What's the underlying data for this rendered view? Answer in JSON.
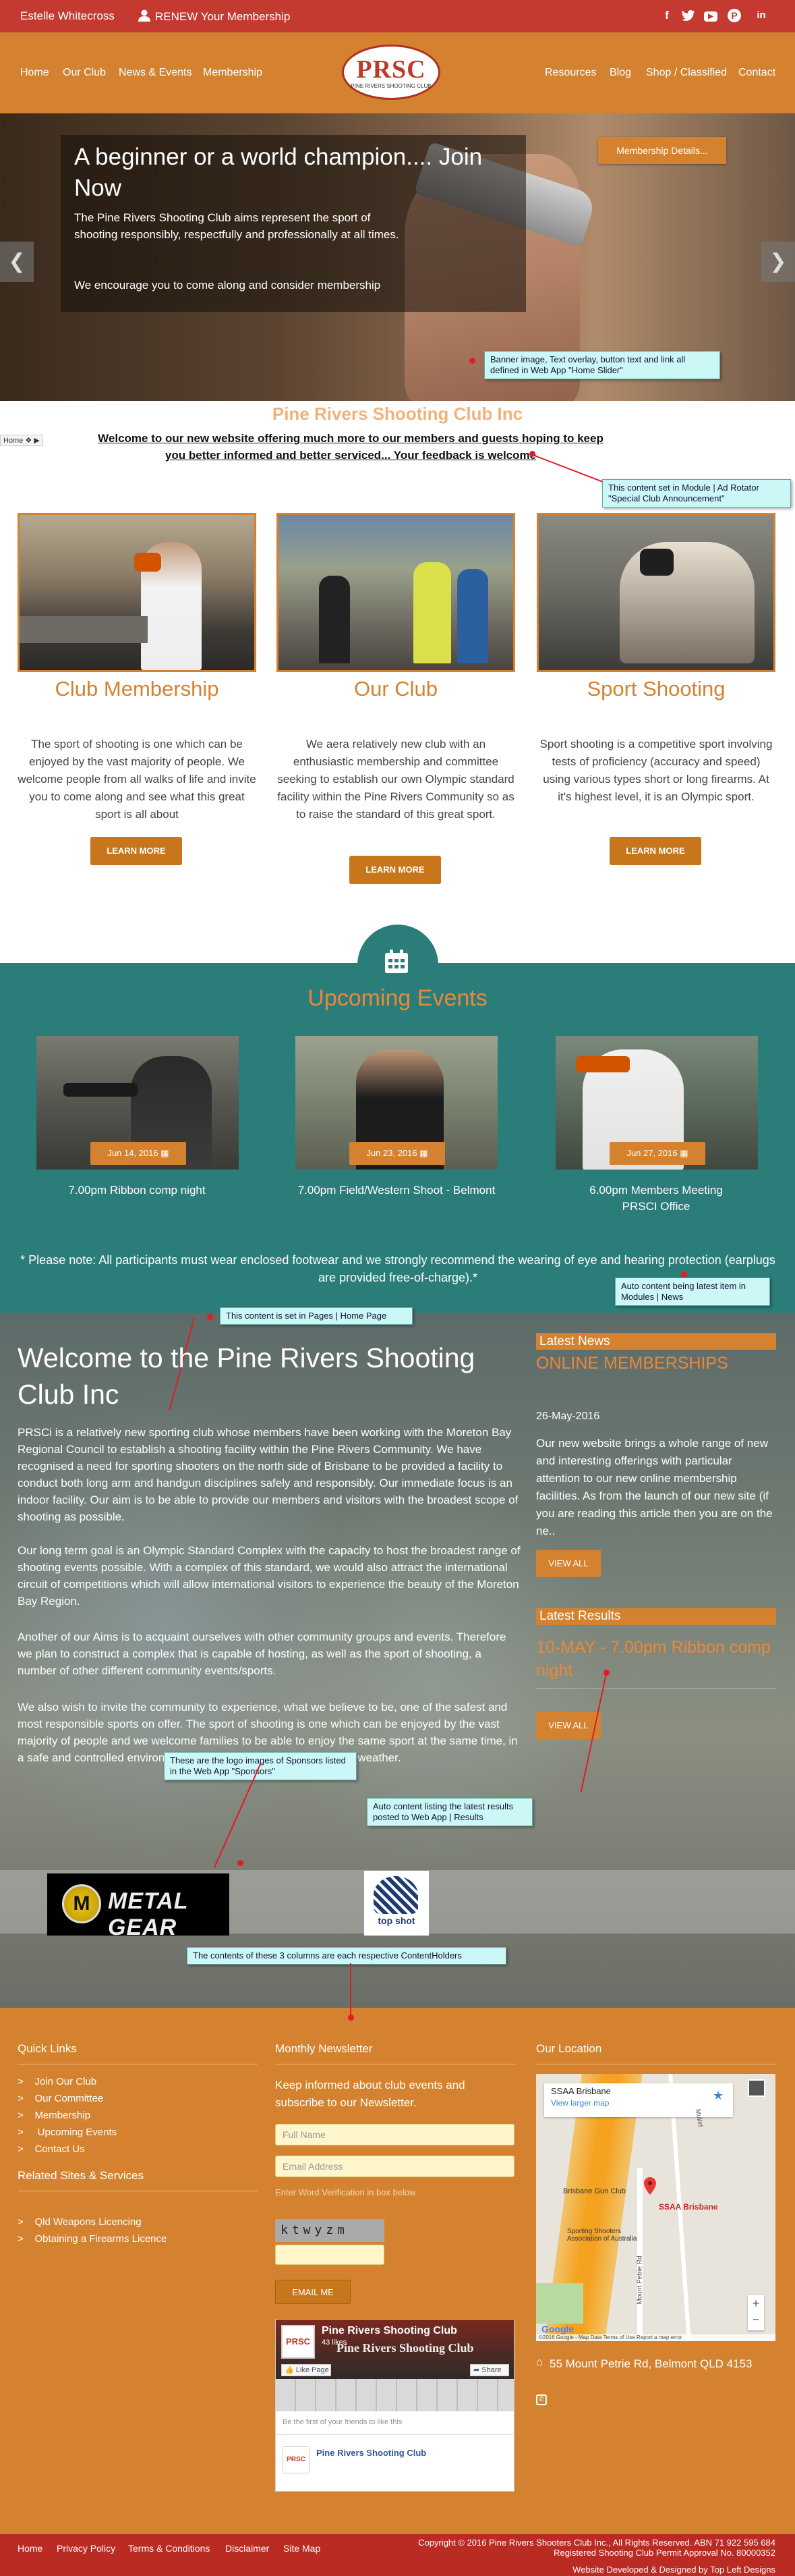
{
  "topbar": {
    "user_name": "Estelle Whitecross",
    "renew_label": "RENEW Your Membership",
    "social": [
      "f",
      "t",
      "▶",
      "P",
      "in"
    ],
    "social_names": [
      "facebook-icon",
      "twitter-icon",
      "youtube-icon",
      "pinterest-icon",
      "linkedin-icon"
    ]
  },
  "nav": {
    "left": [
      "Home",
      "Our Club",
      "News & Events",
      "Membership"
    ],
    "right": [
      "Resources",
      "Blog",
      "Shop / Classified",
      "Contact"
    ],
    "logo_text": "PRSC",
    "logo_sub": "PINE RIVERS SHOOTING CLUB"
  },
  "hero": {
    "heading": "A beginner or a world champion.... Join Now",
    "para1": "The Pine Rivers Shooting Club aims represent the sport of shooting responsibly, respectfully and professionally at all times.",
    "para2": "We encourage you to come along and consider membership",
    "button": "Membership Details...",
    "prev": "❮",
    "next": "❯"
  },
  "notes": {
    "banner": "Banner image, Text overlay, button text and link all defined in Web App \"Home Slider\"",
    "announcement": "This content set in Module | Ad Rotator \"Special Club Announcement\"",
    "pages": "This content is set in Pages | Home Page",
    "autonews": "Auto content being latest item in Modules | News",
    "sponsors": "These are the logo images of Sponsors listed in the Web App \"Sponsors\"",
    "results": "Auto content listing the latest results posted to Web App | Results",
    "contentholders": "The contents of these 3 columns are each respective ContentHolders"
  },
  "announcement": {
    "club_title": "Pine Rivers Shooting Club Inc",
    "welcome_text": "Welcome to our new website offering much more to our members and guests hoping to keep you better informed and better serviced... Your feedback is welcome",
    "breadcrumb": "Home ❖ ▶"
  },
  "features": [
    {
      "title": "Club Membership",
      "text": "The sport of shooting is one which can be enjoyed by the vast majority of people. We welcome people from all walks of life and invite you to come along and see what this great sport is all about",
      "button": "LEARN MORE"
    },
    {
      "title": "Our Club",
      "text": "We aera  relatively new club with an enthusiastic membership and committee seeking to establish our own Olympic standard facility within the Pine Rivers Community so as to raise the standard of this great sport.",
      "button": "LEARN MORE"
    },
    {
      "title": "Sport Shooting",
      "text": "Sport shooting is a competitive sport involving tests of proficiency (accuracy and speed) using various types short or long firearms. At it's highest level, it is an Olympic sport.",
      "button": "LEARN MORE"
    }
  ],
  "events": {
    "title": "Upcoming Events",
    "items": [
      {
        "date": "Jun 14, 2016",
        "name": "7.00pm Ribbon comp night"
      },
      {
        "date": "Jun 23, 2016",
        "name": "7.00pm Field/Western Shoot - Belmont"
      },
      {
        "date": "Jun 27, 2016",
        "name": "6.00pm Members Meeting PRSCI Office"
      }
    ],
    "note": "* Please note: All participants must wear enclosed footwear and we strongly recommend the wearing of eye and hearing protection (earplugs are provided free-of-charge).*"
  },
  "welcome": {
    "title": "Welcome to the Pine Rivers Shooting Club Inc",
    "paras": [
      "PRSCi is a relatively new sporting club whose members have been working with the Moreton Bay Regional Council to establish a shooting facility within the Pine Rivers Community. We have recognised a need for sporting shooters on the north side of Brisbane to be provided a facility to conduct both long arm and handgun disciplines safely and responsibly. Our immediate focus is an indoor facility. Our aim is to be able to provide our members and visitors with the broadest scope of shooting as possible.",
      "Our long term goal is an Olympic Standard Complex with the capacity to host the broadest range of shooting events possible. With a complex of this standard, we would also attract the international circuit of competitions which will allow international visitors to experience the beauty of the Moreton Bay Region.",
      "Another of our Aims is to acquaint ourselves with other community groups and events. Therefore we plan to construct a complex that is capable of hosting, as well as the sport of shooting, a number of other different community events/sports.",
      "We also wish to invite the community to experience, what we believe to be, one of the safest and most responsible sports on offer. The sport of shooting is one which can be enjoyed by the vast majority of people and we welcome families to be able to enjoy the same sport at the same time, in a safe and controlled environment, and with an indoor facility, in all weather."
    ],
    "latest_news": "Latest News",
    "news_title": "ONLINE MEMBERSHIPS",
    "news_date": "26-May-2016",
    "news_text": "Our new website brings a whole range of new and interesting offerings with particular attention to our new online membership facilities. As from the launch of our new site (if you are reading this article then you are on the ne..",
    "view_all": "VIEW ALL",
    "latest_results": "Latest Results",
    "result_title": "10-MAY - 7.00pm Ribbon comp night",
    "sponsor1": "METAL GEAR",
    "sponsor2": "top shot"
  },
  "footer": {
    "quick_links_title": "Quick Links",
    "quick_links": [
      "Join Our Club",
      "Our Committee",
      "Membership",
      " Upcoming Events",
      "Contact Us"
    ],
    "related_title": "Related Sites & Services",
    "related": [
      "Qld Weapons Licencing",
      "Obtaining a Firearms Licence"
    ],
    "newsletter_title": "Monthly Newsletter",
    "newsletter_text": "Keep informed about club events and subscribe to our Newsletter.",
    "fullname_placeholder": "Full Name",
    "email_placeholder": "Email Address",
    "verify_label": "Enter Word Verification in box below",
    "captcha": "ktwyzm",
    "email_btn": "EMAIL ME",
    "location_title": "Our Location",
    "map_place": "SSAA Brisbane",
    "map_link": "View larger map",
    "map_label1": "Brisbane Gun Club",
    "map_label2": "Sporting Shooters Association of Australia",
    "map_pin_label": "SSAA Brisbane",
    "map_road": "Mount Petrie Rd",
    "map_road2": "Mullet",
    "map_footer": "©2016 Google - Map Data  Terms of Use  Report a map error",
    "google": "Google",
    "address": "55 Mount Petrie Rd, Belmont QLD 4153",
    "fb_page": "Pine Rivers Shooting Club",
    "fb_likes": "43 likes",
    "fb_like": "Like Page",
    "fb_share": "Share",
    "fb_friends": "Be the first of your friends to like this",
    "fb_post": "Pine Rivers Shooting Club"
  },
  "bottom": {
    "links": [
      "Home",
      "Privacy Policy",
      "Terms & Conditions",
      "Disclaimer",
      "Site Map"
    ],
    "copyright": "Copyright © 2016 Pine Rivers Shooters Club Inc., All Rights Reserved. ABN 71 922 595 684",
    "permit": "Registered Shooting Club Permit Approval No. 80000352",
    "credit": "Website Developed & Designed by Top Left Designs"
  },
  "colors": {
    "accent": "#d4822f",
    "teal": "#2b7d79",
    "topbar": "#c43a31",
    "note_bg": "#ccf7f7"
  }
}
